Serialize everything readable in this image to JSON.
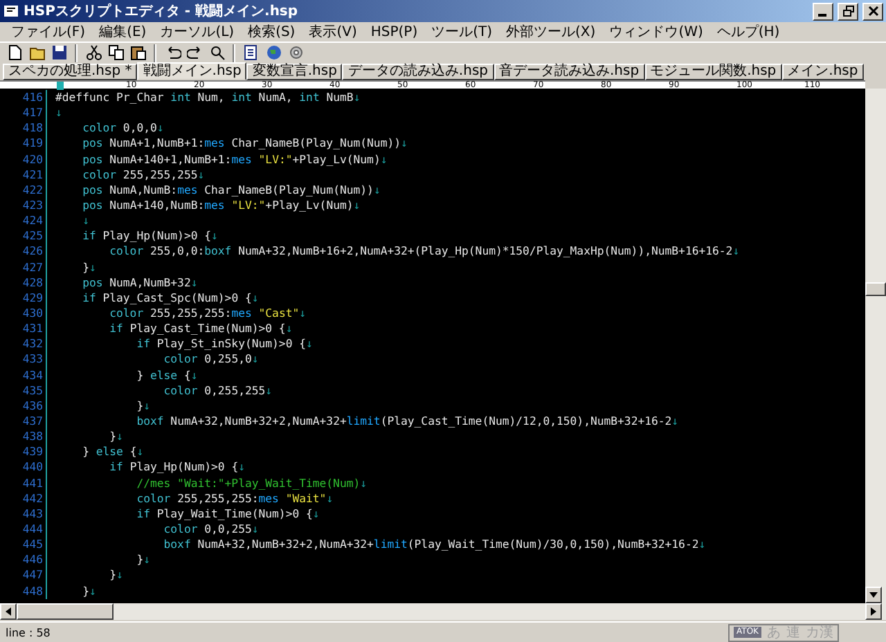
{
  "window": {
    "title": "HSPスクリプトエディタ - 戦闘メイン.hsp"
  },
  "menu": [
    "ファイル(F)",
    "編集(E)",
    "カーソル(L)",
    "検索(S)",
    "表示(V)",
    "HSP(P)",
    "ツール(T)",
    "外部ツール(X)",
    "ウィンドウ(W)",
    "ヘルプ(H)"
  ],
  "tabs": [
    {
      "label": "スペカの処理.hsp *",
      "selected": false
    },
    {
      "label": "戦闘メイン.hsp",
      "selected": true
    },
    {
      "label": "変数宣言.hsp",
      "selected": false
    },
    {
      "label": "データの読み込み.hsp",
      "selected": false
    },
    {
      "label": "音データ読み込み.hsp",
      "selected": false
    },
    {
      "label": "モジュール関数.hsp",
      "selected": false
    },
    {
      "label": "メイン.hsp",
      "selected": false
    }
  ],
  "ruler": [
    "10",
    "20",
    "30",
    "40",
    "50",
    "60",
    "70",
    "80",
    "90",
    "100",
    "110"
  ],
  "code": {
    "lines": [
      {
        "number": "416",
        "tokens": [
          {
            "kind": "plain",
            "text": "#deffunc Pr_Char "
          },
          {
            "kind": "keyword",
            "text": "int"
          },
          {
            "kind": "plain",
            "text": " Num, "
          },
          {
            "kind": "keyword",
            "text": "int"
          },
          {
            "kind": "plain",
            "text": " NumA, "
          },
          {
            "kind": "keyword",
            "text": "int"
          },
          {
            "kind": "plain",
            "text": " NumB"
          },
          {
            "kind": "eol",
            "text": "↓"
          }
        ]
      },
      {
        "number": "417",
        "tokens": [
          {
            "kind": "eol",
            "text": "↓"
          }
        ]
      },
      {
        "number": "418",
        "tokens": [
          {
            "kind": "keyword",
            "text": "    color"
          },
          {
            "kind": "plain",
            "text": " 0,0,0"
          },
          {
            "kind": "eol",
            "text": "↓"
          }
        ]
      },
      {
        "number": "419",
        "tokens": [
          {
            "kind": "keyword",
            "text": "    pos"
          },
          {
            "kind": "plain",
            "text": " NumA+1,NumB+1:"
          },
          {
            "kind": "builtin",
            "text": "mes"
          },
          {
            "kind": "plain",
            "text": " Char_NameB(Play_Num(Num))"
          },
          {
            "kind": "eol",
            "text": "↓"
          }
        ]
      },
      {
        "number": "420",
        "tokens": [
          {
            "kind": "keyword",
            "text": "    pos"
          },
          {
            "kind": "plain",
            "text": " NumA+140+1,NumB+1:"
          },
          {
            "kind": "builtin",
            "text": "mes"
          },
          {
            "kind": "string",
            "text": " \"LV:\""
          },
          {
            "kind": "plain",
            "text": "+Play_Lv(Num)"
          },
          {
            "kind": "eol",
            "text": "↓"
          }
        ]
      },
      {
        "number": "421",
        "tokens": [
          {
            "kind": "keyword",
            "text": "    color"
          },
          {
            "kind": "plain",
            "text": " 255,255,255"
          },
          {
            "kind": "eol",
            "text": "↓"
          }
        ]
      },
      {
        "number": "422",
        "tokens": [
          {
            "kind": "keyword",
            "text": "    pos"
          },
          {
            "kind": "plain",
            "text": " NumA,NumB:"
          },
          {
            "kind": "builtin",
            "text": "mes"
          },
          {
            "kind": "plain",
            "text": " Char_NameB(Play_Num(Num))"
          },
          {
            "kind": "eol",
            "text": "↓"
          }
        ]
      },
      {
        "number": "423",
        "tokens": [
          {
            "kind": "keyword",
            "text": "    pos"
          },
          {
            "kind": "plain",
            "text": " NumA+140,NumB:"
          },
          {
            "kind": "builtin",
            "text": "mes"
          },
          {
            "kind": "string",
            "text": " \"LV:\""
          },
          {
            "kind": "plain",
            "text": "+Play_Lv(Num)"
          },
          {
            "kind": "eol",
            "text": "↓"
          }
        ]
      },
      {
        "number": "424",
        "tokens": [
          {
            "kind": "eol",
            "text": "    ↓"
          }
        ]
      },
      {
        "number": "425",
        "tokens": [
          {
            "kind": "keyword",
            "text": "    if"
          },
          {
            "kind": "plain",
            "text": " Play_Hp(Num)>0 {"
          },
          {
            "kind": "eol",
            "text": "↓"
          }
        ]
      },
      {
        "number": "426",
        "tokens": [
          {
            "kind": "keyword",
            "text": "        color"
          },
          {
            "kind": "plain",
            "text": " 255,0,0:"
          },
          {
            "kind": "keyword",
            "text": "boxf"
          },
          {
            "kind": "plain",
            "text": " NumA+32,NumB+16+2,NumA+32+(Play_Hp(Num)*150/Play_MaxHp(Num)),NumB+16+16-2"
          },
          {
            "kind": "eol",
            "text": "↓"
          }
        ]
      },
      {
        "number": "427",
        "tokens": [
          {
            "kind": "plain",
            "text": "    }"
          },
          {
            "kind": "eol",
            "text": "↓"
          }
        ]
      },
      {
        "number": "428",
        "tokens": [
          {
            "kind": "keyword",
            "text": "    pos"
          },
          {
            "kind": "plain",
            "text": " NumA,NumB+32"
          },
          {
            "kind": "eol",
            "text": "↓"
          }
        ]
      },
      {
        "number": "429",
        "tokens": [
          {
            "kind": "keyword",
            "text": "    if"
          },
          {
            "kind": "plain",
            "text": " Play_Cast_Spc(Num)>0 {"
          },
          {
            "kind": "eol",
            "text": "↓"
          }
        ]
      },
      {
        "number": "430",
        "tokens": [
          {
            "kind": "keyword",
            "text": "        color"
          },
          {
            "kind": "plain",
            "text": " 255,255,255:"
          },
          {
            "kind": "builtin",
            "text": "mes"
          },
          {
            "kind": "string",
            "text": " \"Cast\""
          },
          {
            "kind": "eol",
            "text": "↓"
          }
        ]
      },
      {
        "number": "431",
        "tokens": [
          {
            "kind": "keyword",
            "text": "        if"
          },
          {
            "kind": "plain",
            "text": " Play_Cast_Time(Num)>0 {"
          },
          {
            "kind": "eol",
            "text": "↓"
          }
        ]
      },
      {
        "number": "432",
        "tokens": [
          {
            "kind": "keyword",
            "text": "            if"
          },
          {
            "kind": "plain",
            "text": " Play_St_inSky(Num)>0 {"
          },
          {
            "kind": "eol",
            "text": "↓"
          }
        ]
      },
      {
        "number": "433",
        "tokens": [
          {
            "kind": "keyword",
            "text": "                color"
          },
          {
            "kind": "plain",
            "text": " 0,255,0"
          },
          {
            "kind": "eol",
            "text": "↓"
          }
        ]
      },
      {
        "number": "434",
        "tokens": [
          {
            "kind": "plain",
            "text": "            } "
          },
          {
            "kind": "keyword",
            "text": "else"
          },
          {
            "kind": "plain",
            "text": " {"
          },
          {
            "kind": "eol",
            "text": "↓"
          }
        ]
      },
      {
        "number": "435",
        "tokens": [
          {
            "kind": "keyword",
            "text": "                color"
          },
          {
            "kind": "plain",
            "text": " 0,255,255"
          },
          {
            "kind": "eol",
            "text": "↓"
          }
        ]
      },
      {
        "number": "436",
        "tokens": [
          {
            "kind": "plain",
            "text": "            }"
          },
          {
            "kind": "eol",
            "text": "↓"
          }
        ]
      },
      {
        "number": "437",
        "tokens": [
          {
            "kind": "keyword",
            "text": "            boxf"
          },
          {
            "kind": "plain",
            "text": " NumA+32,NumB+32+2,NumA+32+"
          },
          {
            "kind": "builtin",
            "text": "limit"
          },
          {
            "kind": "plain",
            "text": "(Play_Cast_Time(Num)/12,0,150),NumB+32+16-2"
          },
          {
            "kind": "eol",
            "text": "↓"
          }
        ]
      },
      {
        "number": "438",
        "tokens": [
          {
            "kind": "plain",
            "text": "        }"
          },
          {
            "kind": "eol",
            "text": "↓"
          }
        ]
      },
      {
        "number": "439",
        "tokens": [
          {
            "kind": "plain",
            "text": "    } "
          },
          {
            "kind": "keyword",
            "text": "else"
          },
          {
            "kind": "plain",
            "text": " {"
          },
          {
            "kind": "eol",
            "text": "↓"
          }
        ]
      },
      {
        "number": "440",
        "tokens": [
          {
            "kind": "keyword",
            "text": "        if"
          },
          {
            "kind": "plain",
            "text": " Play_Hp(Num)>0 {"
          },
          {
            "kind": "eol",
            "text": "↓"
          }
        ]
      },
      {
        "number": "441",
        "tokens": [
          {
            "kind": "comment",
            "text": "            //mes \"Wait:\"+Play_Wait_Time(Num)"
          },
          {
            "kind": "eol",
            "text": "↓"
          }
        ]
      },
      {
        "number": "442",
        "tokens": [
          {
            "kind": "keyword",
            "text": "            color"
          },
          {
            "kind": "plain",
            "text": " 255,255,255:"
          },
          {
            "kind": "builtin",
            "text": "mes"
          },
          {
            "kind": "string",
            "text": " \"Wait\""
          },
          {
            "kind": "eol",
            "text": "↓"
          }
        ]
      },
      {
        "number": "443",
        "tokens": [
          {
            "kind": "keyword",
            "text": "            if"
          },
          {
            "kind": "plain",
            "text": " Play_Wait_Time(Num)>0 {"
          },
          {
            "kind": "eol",
            "text": "↓"
          }
        ]
      },
      {
        "number": "444",
        "tokens": [
          {
            "kind": "keyword",
            "text": "                color"
          },
          {
            "kind": "plain",
            "text": " 0,0,255"
          },
          {
            "kind": "eol",
            "text": "↓"
          }
        ]
      },
      {
        "number": "445",
        "tokens": [
          {
            "kind": "keyword",
            "text": "                boxf"
          },
          {
            "kind": "plain",
            "text": " NumA+32,NumB+32+2,NumA+32+"
          },
          {
            "kind": "builtin",
            "text": "limit"
          },
          {
            "kind": "plain",
            "text": "(Play_Wait_Time(Num)/30,0,150),NumB+32+16-2"
          },
          {
            "kind": "eol",
            "text": "↓"
          }
        ]
      },
      {
        "number": "446",
        "tokens": [
          {
            "kind": "plain",
            "text": "            }"
          },
          {
            "kind": "eol",
            "text": "↓"
          }
        ]
      },
      {
        "number": "447",
        "tokens": [
          {
            "kind": "plain",
            "text": "        }"
          },
          {
            "kind": "eol",
            "text": "↓"
          }
        ]
      },
      {
        "number": "448",
        "tokens": [
          {
            "kind": "plain",
            "text": "    }"
          },
          {
            "kind": "eol",
            "text": "↓"
          }
        ]
      }
    ]
  },
  "status_bar": {
    "text": "line : 58"
  },
  "ime_bar": {
    "name": "ATOK",
    "modes": [
      "あ",
      "連",
      "カ漢"
    ]
  }
}
